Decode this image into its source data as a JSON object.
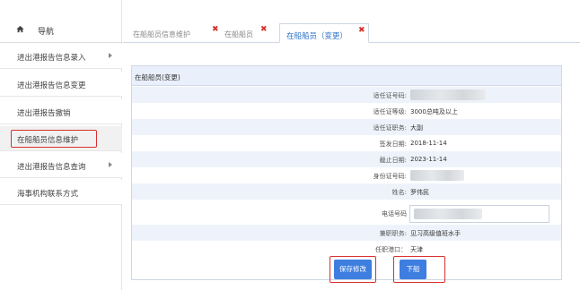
{
  "nav": {
    "title": "导航",
    "items": [
      {
        "label": "进出港报告信息录入",
        "has_sub": true
      },
      {
        "label": "进出港报告信息变更",
        "has_sub": false
      },
      {
        "label": "进出港报告撤销",
        "has_sub": false
      },
      {
        "label": "在船船员信息维护",
        "has_sub": false,
        "active": true
      },
      {
        "label": "进出港报告信息查询",
        "has_sub": true
      },
      {
        "label": "海事机构联系方式",
        "has_sub": false
      }
    ]
  },
  "tabs": [
    {
      "label": "在船船员信息维护",
      "close": "✖"
    },
    {
      "label": "在船船员",
      "close": "✖"
    },
    {
      "label": "在船船员（变更）",
      "close": "✖",
      "active": true
    }
  ],
  "panel": {
    "title": "在船船员(变更)",
    "fields": [
      {
        "label": "适任证号码:",
        "value": ""
      },
      {
        "label": "适任证等级:",
        "value": "3000总吨及以上"
      },
      {
        "label": "适任证职务:",
        "value": "大副"
      },
      {
        "label": "签发日期:",
        "value": "2018-11-14"
      },
      {
        "label": "截止日期:",
        "value": "2023-11-14"
      },
      {
        "label": "身份证号码:",
        "value": ""
      },
      {
        "label": "姓名:",
        "value": "罗伟民"
      },
      {
        "label": "电话号码",
        "value": ""
      },
      {
        "label": "兼职职务:",
        "value": "见习高级值班水手"
      },
      {
        "label": "任职港口：",
        "value": "天津"
      }
    ]
  },
  "buttons": {
    "save": "保存修改",
    "disembark": "下船"
  }
}
